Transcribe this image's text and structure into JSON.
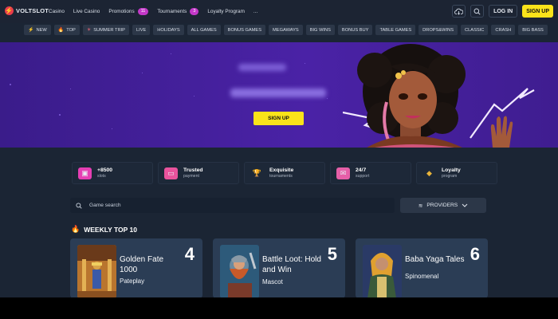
{
  "brand": {
    "name": "VOLTSLOT"
  },
  "nav": {
    "items": [
      {
        "label": "Casino"
      },
      {
        "label": "Live Casino"
      },
      {
        "label": "Promotions",
        "badge": "11"
      },
      {
        "label": "Tournaments",
        "badge": "3"
      },
      {
        "label": "Loyalty Program"
      },
      {
        "label": "..."
      }
    ],
    "login_label": "LOG IN",
    "signup_label": "SIGN UP"
  },
  "chips": [
    {
      "label": "NEW",
      "icon": "bolt-icon"
    },
    {
      "label": "TOP",
      "icon": "flame-icon"
    },
    {
      "label": "SUMMER TRIP",
      "icon": "sun-icon"
    },
    {
      "label": "LIVE"
    },
    {
      "label": "HOLIDAYS"
    },
    {
      "label": "ALL GAMES"
    },
    {
      "label": "BONUS GAMES"
    },
    {
      "label": "MEGAWAYS"
    },
    {
      "label": "BIG WINS"
    },
    {
      "label": "BONUS BUY"
    },
    {
      "label": "TABLE GAMES"
    },
    {
      "label": "DROPS&WINS"
    },
    {
      "label": "CLASSIC"
    },
    {
      "label": "CRASH"
    },
    {
      "label": "BIG BASS"
    }
  ],
  "hero": {
    "signup_label": "SIGN UP"
  },
  "features": [
    {
      "title": "+8500",
      "subtitle": "slots",
      "icon": "slot-icon",
      "color": "#e63fb4"
    },
    {
      "title": "Trusted",
      "subtitle": "payment",
      "icon": "card-icon",
      "color": "#e9539d"
    },
    {
      "title": "Exquisite",
      "subtitle": "tournaments",
      "icon": "trophy-icon",
      "color": "#d84aa5"
    },
    {
      "title": "24/7",
      "subtitle": "support",
      "icon": "chat-icon",
      "color": "#e65fa8"
    },
    {
      "title": "Loyalty",
      "subtitle": "program",
      "icon": "diamond-icon",
      "color": "#e9b43a"
    }
  ],
  "search": {
    "placeholder": "Game search"
  },
  "providers": {
    "label": "PROVIDERS"
  },
  "weekly": {
    "title": "WEEKLY TOP 10"
  },
  "games": [
    {
      "name": "Golden Fate 1000",
      "provider": "Pateplay",
      "rank": "4"
    },
    {
      "name": "Battle Loot: Hold and Win",
      "provider": "Mascot",
      "rank": "5"
    },
    {
      "name": "Baba Yaga Tales",
      "provider": "Spinomenal",
      "rank": "6"
    }
  ]
}
